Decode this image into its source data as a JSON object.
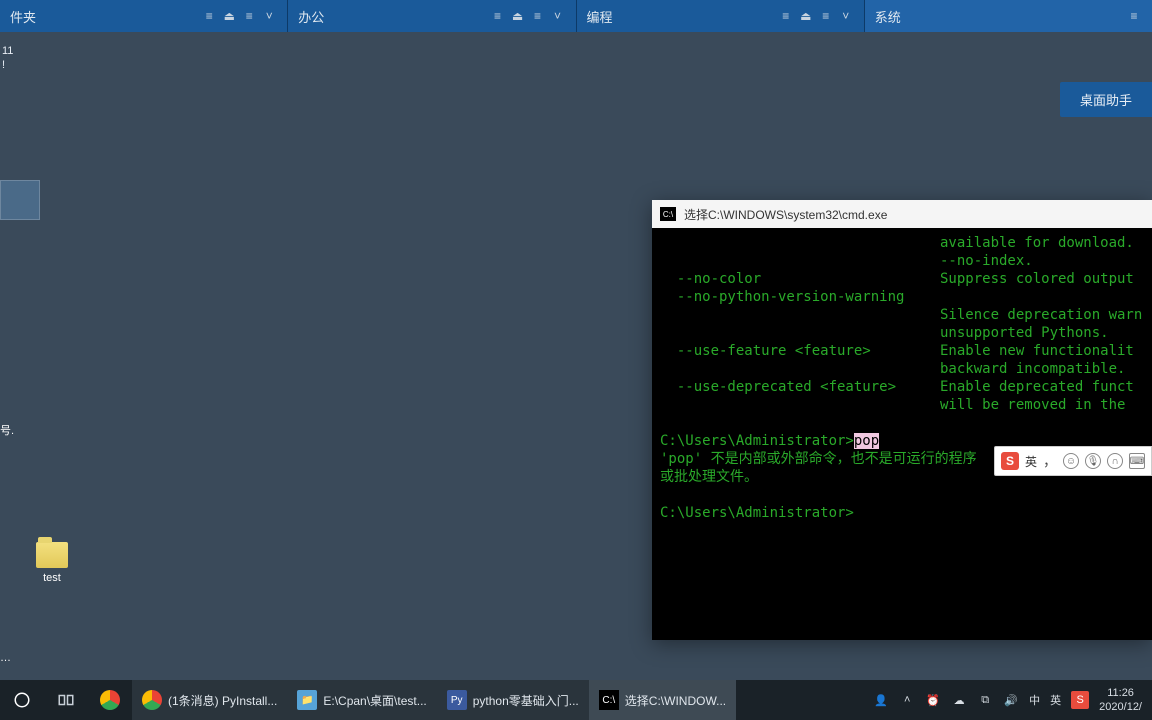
{
  "fence": {
    "sections": [
      {
        "label": "件夹"
      },
      {
        "label": "办公"
      },
      {
        "label": "编程"
      },
      {
        "label": "系统"
      }
    ]
  },
  "desk": {
    "toptext1": "11",
    "toptext2": "!",
    "recycle_stub": "号.",
    "recycle_dots": "…",
    "test_folder": "test"
  },
  "helper": {
    "label": "桌面助手"
  },
  "ime_dock": {
    "lang": "英",
    "comma_icon": "，",
    "face_icon": "☺",
    "mic_icon": "🎤",
    "headset_icon": "🎧",
    "kbd_icon": "⌨"
  },
  "cmd": {
    "title": "选择C:\\WINDOWS\\system32\\cmd.exe",
    "lines": {
      "r1a": "",
      "r1b": "available for download.",
      "r2a": "",
      "r2b": "--no-index.",
      "o1a": "  --no-color",
      "o1b": "Suppress colored output",
      "o2a": "  --no-python-version-warning",
      "o2b1": "Silence deprecation warn",
      "o2b2": "unsupported Pythons.",
      "o3a": "  --use-feature <feature>",
      "o3b1": "Enable new functionalit",
      "o3b2": "backward incompatible.",
      "o4a": "  --use-deprecated <feature>  ",
      "o4b1": "Enable deprecated funct",
      "o4b2": "will be removed in the ",
      "prompt1_pre": "C:\\Users\\Administrator>",
      "prompt1_cmd": "pop",
      "err1": "'pop' 不是内部或外部命令，也不是可运行的程序",
      "err2": "或批处理文件。",
      "prompt2": "C:\\Users\\Administrator>"
    }
  },
  "taskbar": {
    "items": [
      {
        "label": "(1条消息) PyInstall..."
      },
      {
        "label": "E:\\Cpan\\桌面\\test..."
      },
      {
        "label": "python零基础入门..."
      },
      {
        "label": "选择C:\\WINDOW..."
      }
    ],
    "ime_s": "S",
    "ime_cn": "中",
    "ime_en": "英",
    "clock_time": "11:26",
    "clock_date": "2020/12/"
  }
}
